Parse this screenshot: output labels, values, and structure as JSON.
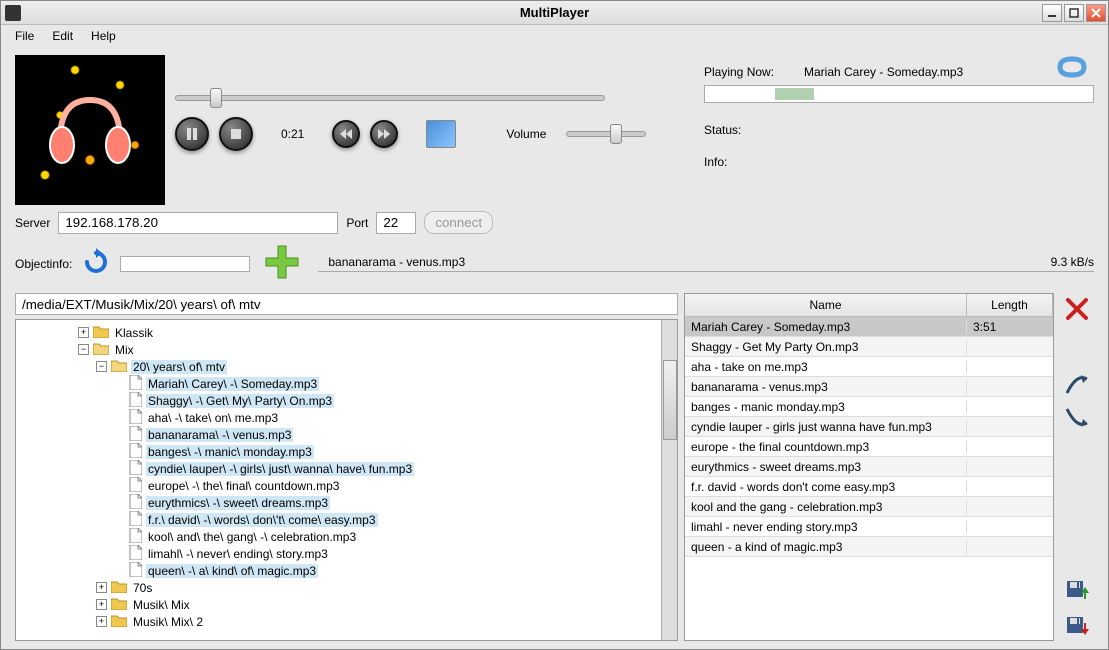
{
  "window": {
    "title": "MultiPlayer"
  },
  "menu": {
    "file": "File",
    "edit": "Edit",
    "help": "Help"
  },
  "player": {
    "time": "0:21",
    "volume_label": "Volume",
    "seek_pos_pct": 8,
    "volume_pos_pct": 55
  },
  "now_playing": {
    "label": "Playing Now:",
    "track": "Mariah Carey - Someday.mp3",
    "status_label": "Status:",
    "status_value": "",
    "info_label": "Info:",
    "info_value": ""
  },
  "server": {
    "label": "Server",
    "host": "192.168.178.20",
    "port_label": "Port",
    "port": "22",
    "connect_label": "connect"
  },
  "objectinfo_label": "Objectinfo:",
  "transfer": {
    "track": "bananarama - venus.mp3",
    "speed": "9.3",
    "unit": "kB/s"
  },
  "path_value": "/media/EXT/Musik/Mix/20\\ years\\ of\\ mtv",
  "tree": {
    "klassik": "Klassik",
    "mix": "Mix",
    "years": "20\\ years\\ of\\ mtv",
    "files": [
      "Mariah\\ Carey\\ -\\ Someday.mp3",
      "Shaggy\\ -\\ Get\\ My\\ Party\\ On.mp3",
      "aha\\ -\\ take\\ on\\ me.mp3",
      "bananarama\\ -\\ venus.mp3",
      "banges\\ -\\ manic\\ monday.mp3",
      "cyndie\\ lauper\\ -\\ girls\\ just\\ wanna\\ have\\ fun.mp3",
      "europe\\ -\\ the\\ final\\ countdown.mp3",
      "eurythmics\\ -\\ sweet\\ dreams.mp3",
      "f.r.\\ david\\ -\\ words\\ don\\'t\\ come\\ easy.mp3",
      "kool\\ and\\ the\\ gang\\ -\\ celebration.mp3",
      "limahl\\ -\\ never\\ ending\\ story.mp3",
      "queen\\ -\\ a\\ kind\\ of\\ magic.mp3"
    ],
    "seventies": "70s",
    "musik_mix": "Musik\\ Mix",
    "musik_mix2": "Musik\\ Mix\\ 2"
  },
  "playlist": {
    "col_name": "Name",
    "col_length": "Length",
    "rows": [
      {
        "name": "Mariah Carey - Someday.mp3",
        "length": "3:51"
      },
      {
        "name": "Shaggy - Get My Party On.mp3",
        "length": ""
      },
      {
        "name": "aha - take on me.mp3",
        "length": ""
      },
      {
        "name": "bananarama - venus.mp3",
        "length": ""
      },
      {
        "name": "banges - manic monday.mp3",
        "length": ""
      },
      {
        "name": "cyndie lauper - girls just wanna have fun.mp3",
        "length": ""
      },
      {
        "name": "europe - the final countdown.mp3",
        "length": ""
      },
      {
        "name": "eurythmics - sweet dreams.mp3",
        "length": ""
      },
      {
        "name": "f.r. david - words don't come easy.mp3",
        "length": ""
      },
      {
        "name": "kool and the gang - celebration.mp3",
        "length": ""
      },
      {
        "name": "limahl - never ending story.mp3",
        "length": ""
      },
      {
        "name": "queen - a kind of magic.mp3",
        "length": ""
      }
    ]
  }
}
